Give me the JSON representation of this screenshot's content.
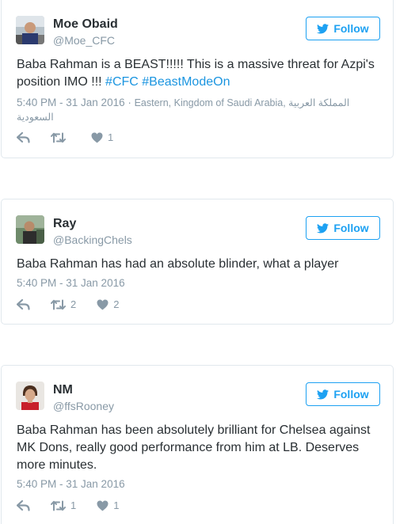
{
  "tweets": [
    {
      "name": "Moe Obaid",
      "handle": "@Moe_CFC",
      "follow_label": "Follow",
      "text": "Baba Rahman is a BEAST!!!!! This is a massive threat for Azpi's position IMO !!! ",
      "hashtags": [
        "#CFC",
        "#BeastModeOn"
      ],
      "timestamp": "5:40 PM - 31 Jan 2016",
      "separator": " · ",
      "location": "Eastern, Kingdom of Saudi Arabia, المملكة العربية السعودية",
      "retweets": "",
      "likes": "1"
    },
    {
      "name": "Ray",
      "handle": "@BackingChels",
      "follow_label": "Follow",
      "text": "Baba Rahman has had an absolute blinder, what a player",
      "timestamp": "5:40 PM - 31 Jan 2016",
      "retweets": "2",
      "likes": "2"
    },
    {
      "name": "NM",
      "handle": "@ffsRooney",
      "follow_label": "Follow",
      "text": "Baba Rahman has been absolutely brilliant for Chelsea against MK Dons, really good performance from him at LB. Deserves more minutes.",
      "timestamp": "5:40 PM - 31 Jan 2016",
      "retweets": "1",
      "likes": "1"
    }
  ],
  "icons": {
    "reply": "reply-icon",
    "retweet": "retweet-icon",
    "like": "heart-icon",
    "follow": "twitter-bird-icon"
  },
  "colors": {
    "accent": "#1da1f2",
    "link": "#1b95e0",
    "muted": "#8899a6",
    "text": "#292f33",
    "border": "#e1e8ed"
  }
}
